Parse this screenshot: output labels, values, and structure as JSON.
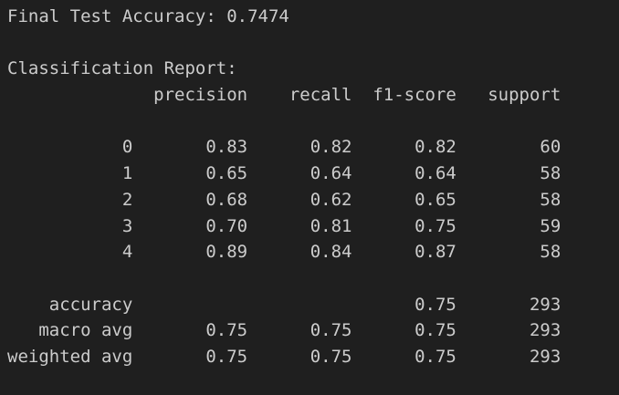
{
  "output": {
    "accuracy_line": "Final Test Accuracy: 0.7474",
    "blank1": "",
    "report_title": "Classification Report:",
    "header": "              precision    recall  f1-score   support",
    "blank2": "",
    "rows": [
      "           0       0.83      0.82      0.82        60",
      "           1       0.65      0.64      0.64        58",
      "           2       0.68      0.62      0.65        58",
      "           3       0.70      0.81      0.75        59",
      "           4       0.89      0.84      0.87        58"
    ],
    "blank3": "",
    "summary": [
      "    accuracy                           0.75       293",
      "   macro avg       0.75      0.75      0.75       293",
      "weighted avg       0.75      0.75      0.75       293"
    ]
  }
}
